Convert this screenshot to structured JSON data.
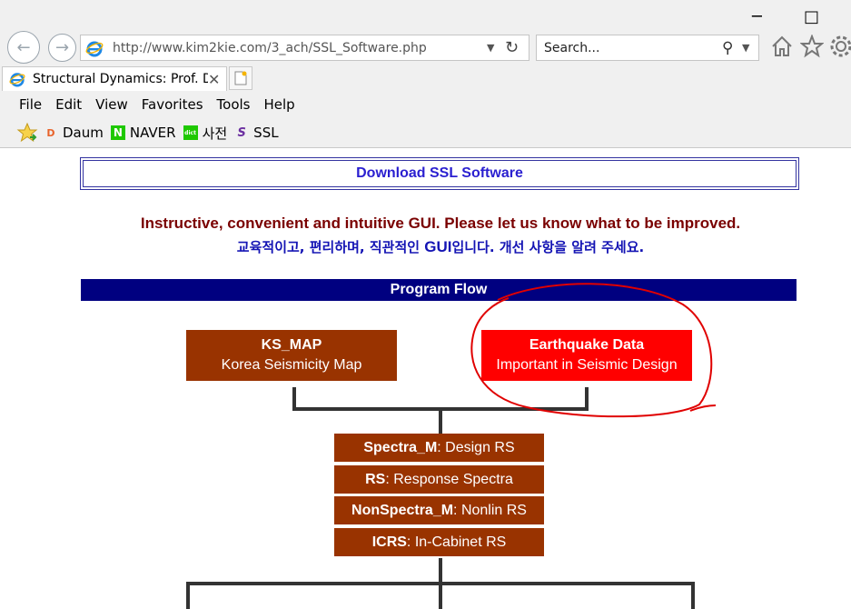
{
  "browser": {
    "window_controls": {
      "minimize": "─",
      "maximize": "□"
    },
    "address": {
      "url": "http://www.kim2kie.com/3_ach/SSL_Software.php"
    },
    "search": {
      "placeholder": "Search..."
    },
    "tab": {
      "title": "Structural Dynamics: Prof. D...",
      "close": "✕"
    },
    "menu": [
      "File",
      "Edit",
      "View",
      "Favorites",
      "Tools",
      "Help"
    ],
    "favorites": [
      {
        "label": "Daum",
        "icon": "daum-icon",
        "glyph": "D",
        "color": "#e8632b"
      },
      {
        "label": "NAVER",
        "icon": "naver-icon",
        "glyph": "N",
        "color": "#1ec800"
      },
      {
        "label": "사전",
        "icon": "dictionary-icon",
        "glyph": "dict",
        "color": "#1ec800"
      },
      {
        "label": "SSL",
        "icon": "ssl-icon",
        "glyph": "S",
        "color": "#6b2fa0"
      }
    ],
    "toolbar_icons": [
      "home-icon",
      "favorites-star-icon",
      "settings-gear-icon"
    ]
  },
  "page": {
    "download_title": "Download SSL Software",
    "intro_en": "Instructive, convenient and intuitive GUI. Please let us know what to be improved.",
    "intro_ko_prefix": "교육적이고, 편리하며, 직관적인 ",
    "intro_ko_gui": "GUI",
    "intro_ko_suffix": "입니다. 개선 사항을 알려 주세요.",
    "program_flow": "Program Flow",
    "ks_map": {
      "title": "KS_MAP",
      "subtitle": "Korea Seismicity Map"
    },
    "eq_data": {
      "title": "Earthquake Data",
      "subtitle": "Important in Seismic Design"
    },
    "modules": [
      {
        "name": "Spectra_M",
        "desc": ": Design RS"
      },
      {
        "name": "RS",
        "desc": ": Response Spectra"
      },
      {
        "name": "NonSpectra_M",
        "desc": ": Nonlin RS"
      },
      {
        "name": "ICRS",
        "desc": ": In-Cabinet RS"
      }
    ]
  },
  "colors": {
    "brown": "#993300",
    "red": "#ff0000",
    "navy": "#000080",
    "annotation": "#e00000"
  }
}
